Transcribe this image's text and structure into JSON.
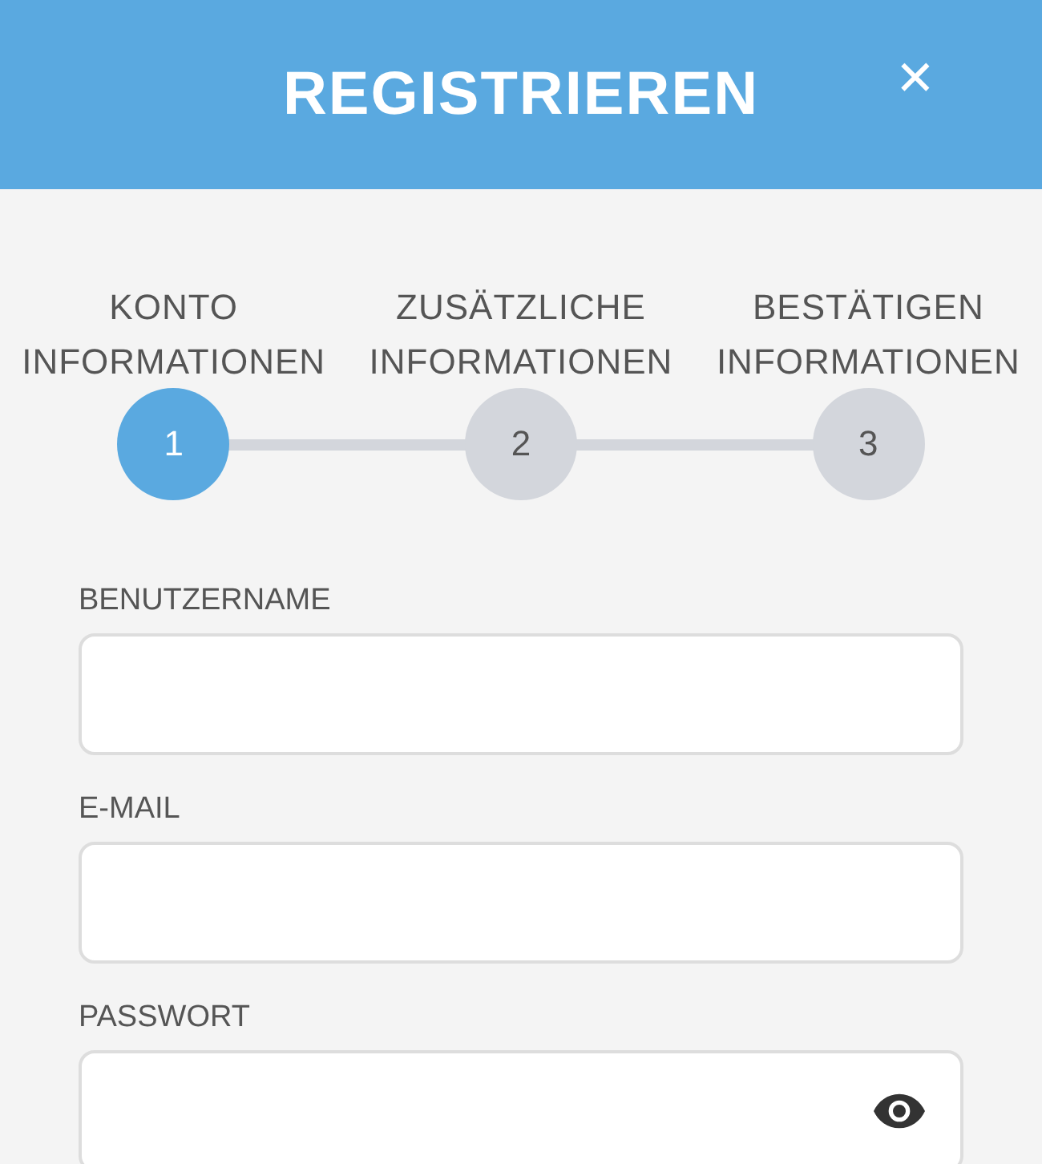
{
  "header": {
    "title": "REGISTRIEREN",
    "close": "✕"
  },
  "steps": [
    {
      "label": "KONTO INFORMATIONEN",
      "number": "1",
      "selected": true
    },
    {
      "label": "ZUSÄTZLICHE INFORMATIONEN",
      "number": "2",
      "selected": false
    },
    {
      "label": "BESTÄTIGEN INFORMATIONEN",
      "number": "3",
      "selected": false
    }
  ],
  "fields": [
    {
      "label": "BENUTZERNAME",
      "kind": "text"
    },
    {
      "label": "E-MAIL",
      "kind": "text"
    },
    {
      "label": "PASSWORT",
      "kind": "password"
    }
  ]
}
